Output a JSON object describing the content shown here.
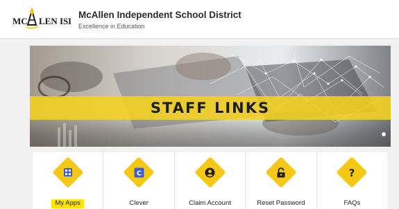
{
  "header": {
    "logo_text": "MCALLEN ISD",
    "district_name": "McAllen Independent School District",
    "tagline": "Excellence in Education"
  },
  "banner": {
    "title": "STAFF LINKS"
  },
  "tiles": [
    {
      "label": "My Apps",
      "icon": "my-apps-icon",
      "highlighted": true
    },
    {
      "label": "Clever",
      "icon": "clever-icon",
      "highlighted": false
    },
    {
      "label": "Claim Account",
      "icon": "user-circle-icon",
      "highlighted": false
    },
    {
      "label": "Reset Password",
      "icon": "lock-icon",
      "highlighted": false
    },
    {
      "label": "FAQs",
      "icon": "question-icon",
      "highlighted": false
    }
  ],
  "colors": {
    "accent_yellow": "#f4c815",
    "highlight": "#ffe600",
    "icon_dark": "#1f1f1f",
    "clever_blue": "#3b5dd6",
    "page_bg": "#f1f1f2"
  }
}
